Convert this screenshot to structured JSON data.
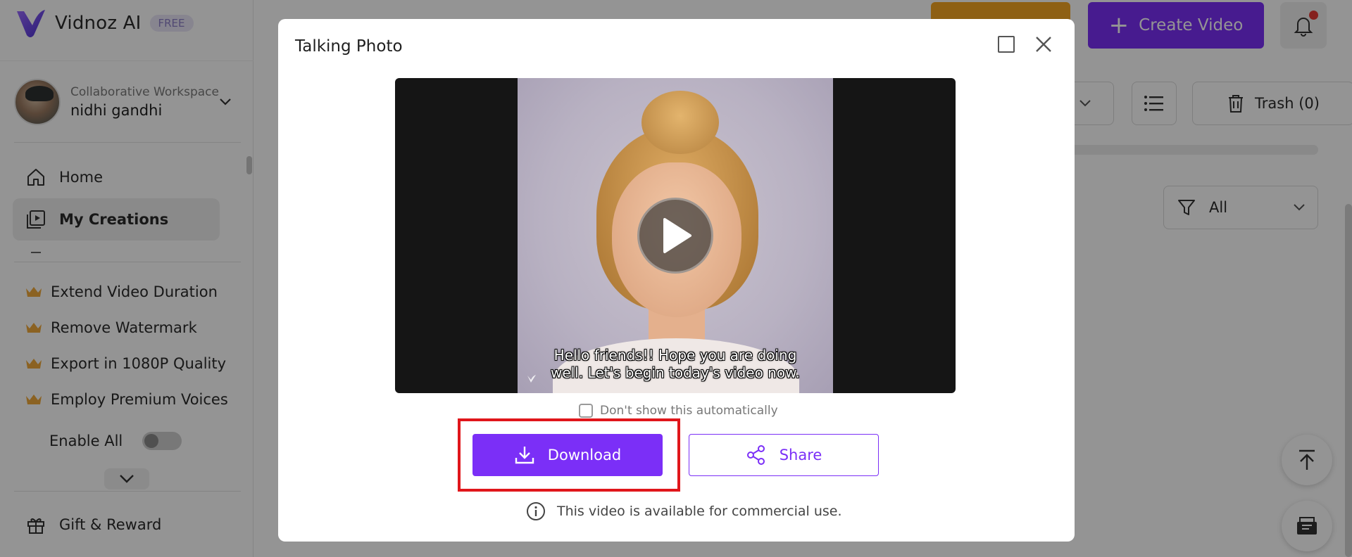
{
  "app": {
    "logo_text": "Vidnoz AI",
    "plan_badge": "FREE"
  },
  "workspace": {
    "label": "Collaborative Workspace",
    "user_name": "nidhi gandhi"
  },
  "nav": {
    "home": "Home",
    "my_creations": "My Creations",
    "gift_reward": "Gift & Reward"
  },
  "premium_features": [
    "Extend Video Duration",
    "Remove Watermark",
    "Export in 1080P Quality",
    "Employ Premium Voices"
  ],
  "enable_all_label": "Enable All",
  "header": {
    "create_video_label": "Create Video"
  },
  "toolbar": {
    "trash_label": "Trash (0)",
    "filter_value": "All"
  },
  "modal": {
    "title": "Talking Photo",
    "caption_line1": "Hello friends!! Hope you are doing",
    "caption_line2": "well. Let's begin today's video now.",
    "dont_show_label": "Don't show this automatically",
    "download_label": "Download",
    "share_label": "Share",
    "commercial_note": "This video is available for commercial use."
  },
  "colors": {
    "accent": "#7b2ff7",
    "highlight": "#e0161b",
    "crown": "#f0a93b",
    "notification_dot": "#e53935"
  },
  "icons": {
    "home": "home-icon",
    "creations": "play-square-icon",
    "gift": "gift-icon",
    "premium": "crown-icon",
    "bell": "bell-icon",
    "trash": "trash-icon",
    "filter": "filter-icon",
    "download": "download-icon",
    "share": "share-icon",
    "info": "info-icon",
    "close": "close-icon",
    "maximize": "maximize-icon"
  }
}
